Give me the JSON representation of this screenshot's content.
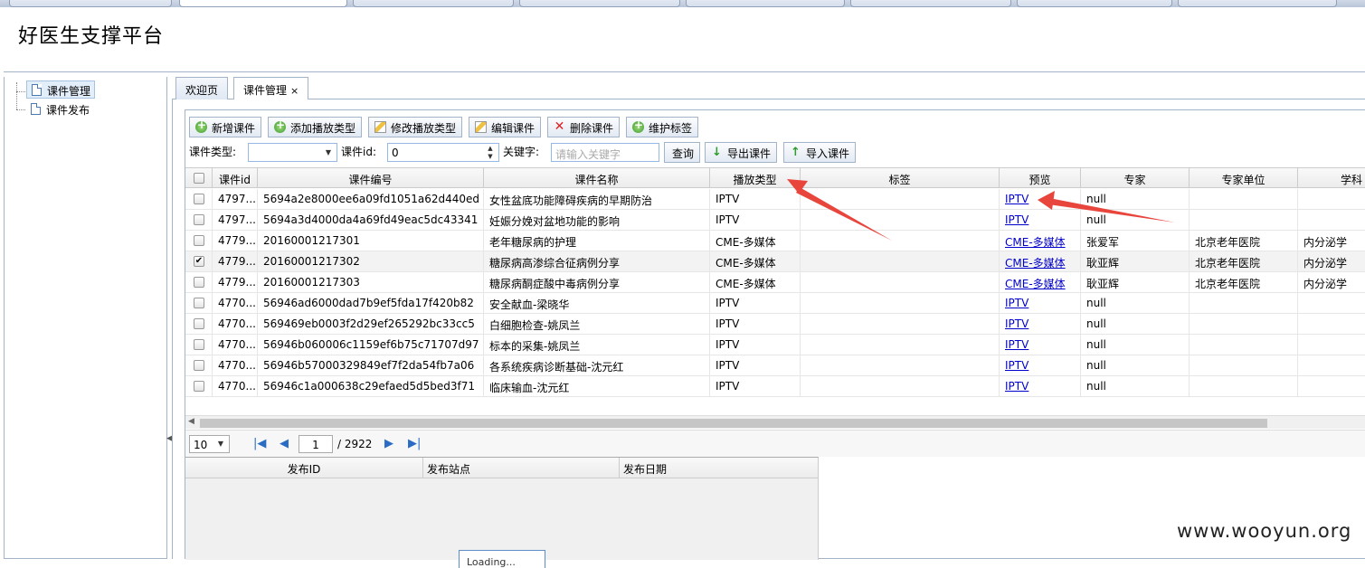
{
  "app": {
    "title": "好医生支撑平台"
  },
  "sidebar": {
    "items": [
      {
        "label": "课件管理",
        "selected": true
      },
      {
        "label": "课件发布",
        "selected": false
      }
    ]
  },
  "tabs": [
    {
      "label": "欢迎页",
      "active": false
    },
    {
      "label": "课件管理",
      "active": true,
      "close": "×"
    }
  ],
  "toolbar": {
    "buttons": [
      {
        "label": "新增课件",
        "icon": "add-icon"
      },
      {
        "label": "添加播放类型",
        "icon": "add-icon"
      },
      {
        "label": "修改播放类型",
        "icon": "edit-icon"
      },
      {
        "label": "编辑课件",
        "icon": "edit-icon"
      },
      {
        "label": "删除课件",
        "icon": "delete-icon"
      },
      {
        "label": "维护标签",
        "icon": "add-icon"
      }
    ]
  },
  "filters": {
    "type_label": "课件类型:",
    "type_value": "",
    "id_label": "课件id:",
    "id_value": "0",
    "keyword_label": "关键字:",
    "keyword_placeholder": "请输入关键字",
    "search_button": "查询",
    "export_button": "导出课件",
    "import_button": "导入课件"
  },
  "grid": {
    "columns": [
      "课件id",
      "课件编号",
      "课件名称",
      "播放类型",
      "标签",
      "预览",
      "专家",
      "专家单位",
      "学科"
    ],
    "rows": [
      {
        "checked": false,
        "id": "4797...",
        "code": "5694a2e8000ee6a09fd1051a62d440ed",
        "name": "女性盆底功能障碍疾病的早期防治",
        "play": "IPTV",
        "tag": "",
        "preview": "IPTV",
        "expert": "null",
        "unit": "",
        "subject": ""
      },
      {
        "checked": false,
        "id": "4797...",
        "code": "5694a3d4000da4a69fd49eac5dc43341",
        "name": "妊娠分娩对盆地功能的影响",
        "play": "IPTV",
        "tag": "",
        "preview": "IPTV",
        "expert": "null",
        "unit": "",
        "subject": ""
      },
      {
        "checked": false,
        "id": "4779...",
        "code": "20160001217301",
        "name": "老年糖尿病的护理",
        "play": "CME-多媒体",
        "tag": "",
        "preview": "CME-多媒体",
        "expert": "张爱军",
        "unit": "北京老年医院",
        "subject": "内分泌学"
      },
      {
        "checked": true,
        "id": "4779...",
        "code": "20160001217302",
        "name": "糖尿病高渗综合征病例分享",
        "play": "CME-多媒体",
        "tag": "",
        "preview": "CME-多媒体",
        "expert": "耿亚辉",
        "unit": "北京老年医院",
        "subject": "内分泌学"
      },
      {
        "checked": false,
        "id": "4779...",
        "code": "20160001217303",
        "name": "糖尿病酮症酸中毒病例分享",
        "play": "CME-多媒体",
        "tag": "",
        "preview": "CME-多媒体",
        "expert": "耿亚辉",
        "unit": "北京老年医院",
        "subject": "内分泌学"
      },
      {
        "checked": false,
        "id": "4770...",
        "code": "56946ad6000dad7b9ef5fda17f420b82",
        "name": "安全献血-梁晓华",
        "play": "IPTV",
        "tag": "",
        "preview": "IPTV",
        "expert": "null",
        "unit": "",
        "subject": ""
      },
      {
        "checked": false,
        "id": "4770...",
        "code": "569469eb0003f2d29ef265292bc33cc5",
        "name": "白细胞检查-姚凤兰",
        "play": "IPTV",
        "tag": "",
        "preview": "IPTV",
        "expert": "null",
        "unit": "",
        "subject": ""
      },
      {
        "checked": false,
        "id": "4770...",
        "code": "56946b060006c1159ef6b75c71707d97",
        "name": "标本的采集-姚凤兰",
        "play": "IPTV",
        "tag": "",
        "preview": "IPTV",
        "expert": "null",
        "unit": "",
        "subject": ""
      },
      {
        "checked": false,
        "id": "4770...",
        "code": "56946b57000329849ef7f2da54fb7a06",
        "name": "各系统疾病诊断基础-沈元红",
        "play": "IPTV",
        "tag": "",
        "preview": "IPTV",
        "expert": "null",
        "unit": "",
        "subject": ""
      },
      {
        "checked": false,
        "id": "4770...",
        "code": "56946c1a000638c29efaed5d5bed3f71",
        "name": "临床输血-沈元红",
        "play": "IPTV",
        "tag": "",
        "preview": "IPTV",
        "expert": "null",
        "unit": "",
        "subject": ""
      }
    ]
  },
  "pager": {
    "page_size": "10",
    "current_page": "1",
    "total_pages": "/ 2922"
  },
  "publish_grid": {
    "columns": [
      "发布ID",
      "发布站点",
      "发布日期"
    ],
    "loading": "Loading..."
  },
  "watermark": "www.wooyun.org",
  "colors": {
    "link": "#0000cc",
    "border": "#a3b3c8",
    "arrow": "#e8453c"
  }
}
